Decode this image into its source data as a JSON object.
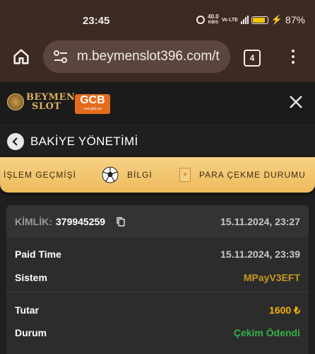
{
  "status_bar": {
    "time": "23:45",
    "net_speed": "40.0",
    "net_unit": "KB/S",
    "volte": "Vo LTE",
    "network": "4.5G",
    "battery_percent": "87%",
    "battery_level": 0.87
  },
  "browser": {
    "url": "m.beymenslot396.com/t",
    "tab_count": "4"
  },
  "site": {
    "logo_line1": "BEYMEN",
    "logo_line2": "SLOT",
    "partner_logo": "GCB",
    "partner_sub": "cert.gcb.cw"
  },
  "page": {
    "title": "BAKİYE YÖNETİMİ"
  },
  "tabs": [
    {
      "label": "İŞLEM GEÇMİŞİ"
    },
    {
      "label": "BİLGİ"
    },
    {
      "label": "PARA ÇEKME DURUMU"
    }
  ],
  "transaction": {
    "id_label": "KİMLİK:",
    "id_value": "379945259",
    "created_at": "15.11.2024, 23:27",
    "rows": [
      {
        "label": "Paid Time",
        "value": "15.11.2024, 23:39",
        "color": "#c8c8c8"
      },
      {
        "label": "Sistem",
        "value": "MPayV3EFT",
        "color": "#c8981e"
      },
      {
        "label": "Tutar",
        "value": "1600 ₺",
        "color": "#f2b20d"
      },
      {
        "label": "Durum",
        "value": "Çekim Ödendi",
        "color": "#33b24a"
      }
    ]
  }
}
